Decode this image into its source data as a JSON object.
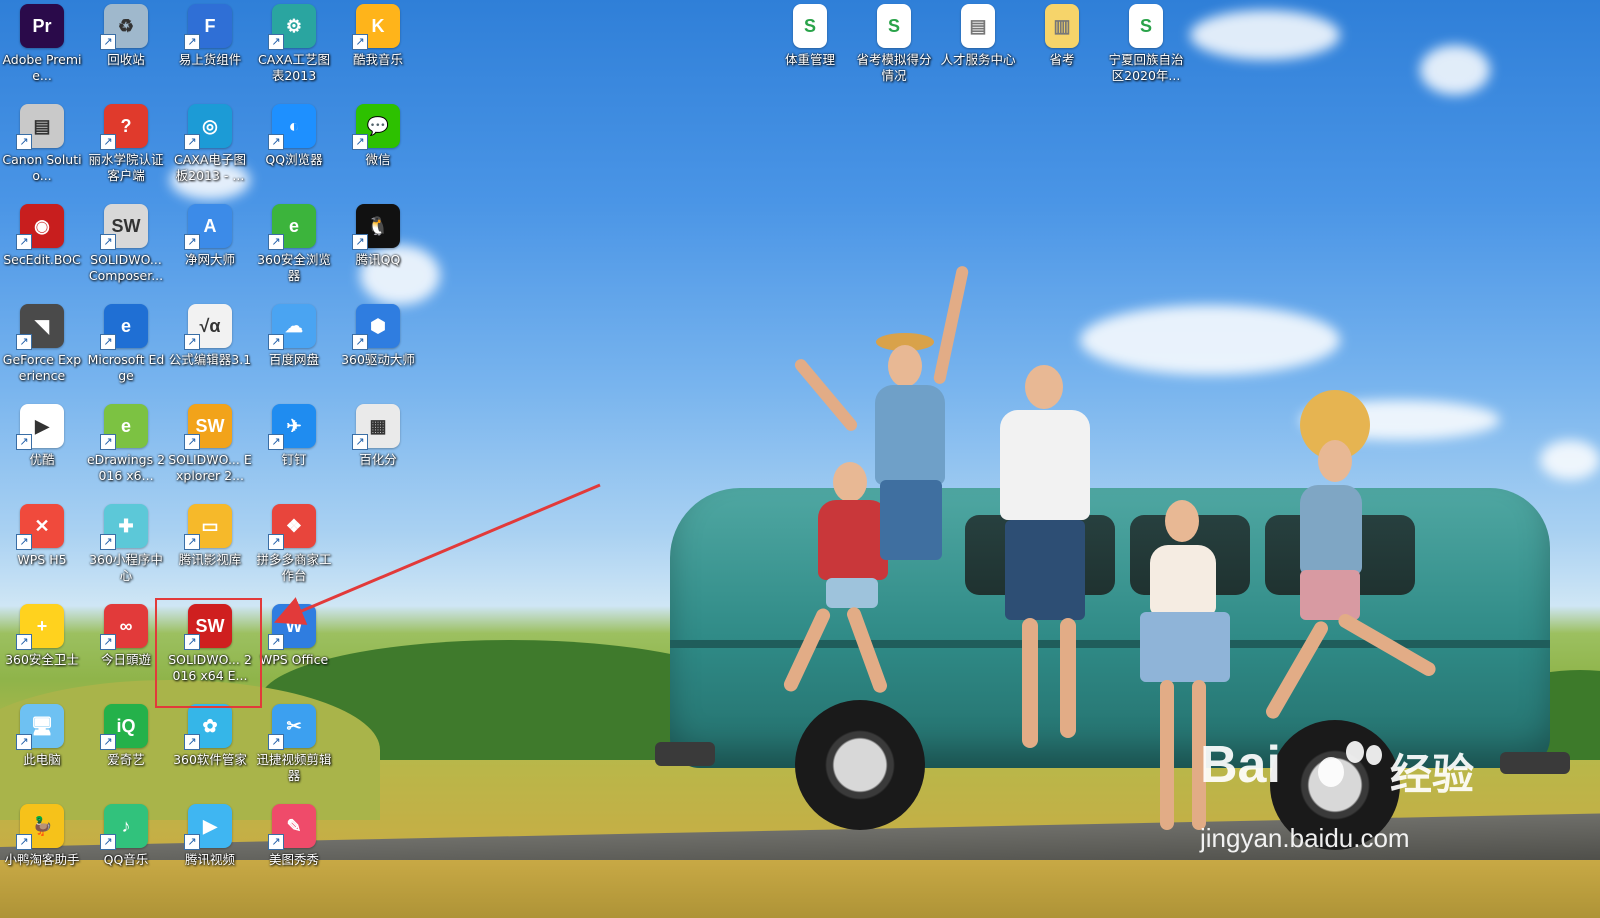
{
  "desktop": {
    "icons": [
      {
        "label": "Adobe Premie...",
        "icon": "premiere-icon",
        "glyph": "Pr",
        "color": "#2a0a4a"
      },
      {
        "label": "回收站",
        "icon": "recycle-bin-icon",
        "glyph": "♻",
        "color": "#9fb8cc"
      },
      {
        "label": "易上货组件",
        "icon": "flag-app-icon",
        "glyph": "F",
        "color": "#2f6fd6"
      },
      {
        "label": "CAXA工艺图表2013",
        "icon": "caxa-process-icon",
        "glyph": "⚙",
        "color": "#2aa5a0"
      },
      {
        "label": "酷我音乐",
        "icon": "kuwo-music-icon",
        "glyph": "K",
        "color": "#ffb41a"
      },
      {
        "label": "Canon Solutio...",
        "icon": "canon-icon",
        "glyph": "▤",
        "color": "#c9c9c9"
      },
      {
        "label": "丽水学院认证客户端",
        "icon": "auth-client-icon",
        "glyph": "?",
        "color": "#e03a2c"
      },
      {
        "label": "CAXA电子图板2013 - ...",
        "icon": "caxa-draft-icon",
        "glyph": "◎",
        "color": "#1c9bd6"
      },
      {
        "label": "QQ浏览器",
        "icon": "qq-browser-icon",
        "glyph": "◐",
        "color": "#1e90ff"
      },
      {
        "label": "微信",
        "icon": "wechat-icon",
        "glyph": "💬",
        "color": "#2dc100"
      },
      {
        "label": "SecEdit.BOC",
        "icon": "secedit-icon",
        "glyph": "◉",
        "color": "#c81e1e"
      },
      {
        "label": "SOLIDWO... Composer...",
        "icon": "solidworks-composer-icon",
        "glyph": "SW",
        "color": "#d8d8d8"
      },
      {
        "label": "净网大师",
        "icon": "jingwang-icon",
        "glyph": "A",
        "color": "#3c8be8"
      },
      {
        "label": "360安全浏览器",
        "icon": "360-browser-icon",
        "glyph": "e",
        "color": "#3cb43c"
      },
      {
        "label": "腾讯QQ",
        "icon": "qq-icon",
        "glyph": "🐧",
        "color": "#111111"
      },
      {
        "label": "GeForce Experience",
        "icon": "geforce-icon",
        "glyph": "◥",
        "color": "#4a4a4a"
      },
      {
        "label": "Microsoft Edge",
        "icon": "edge-icon",
        "glyph": "e",
        "color": "#1f6fd4"
      },
      {
        "label": "公式编辑器3.1",
        "icon": "equation-editor-icon",
        "glyph": "√α",
        "color": "#f2f2f2"
      },
      {
        "label": "百度网盘",
        "icon": "baidu-netdisk-icon",
        "glyph": "☁",
        "color": "#4aa4f2"
      },
      {
        "label": "360驱动大师",
        "icon": "360-driver-icon",
        "glyph": "⬢",
        "color": "#2f7de0"
      },
      {
        "label": "优酷",
        "icon": "youku-icon",
        "glyph": "▶",
        "color": "#ffffff"
      },
      {
        "label": "eDrawings 2016 x6...",
        "icon": "edrawings-icon",
        "glyph": "e",
        "color": "#7cc242"
      },
      {
        "label": "SOLIDWO... Explorer 2...",
        "icon": "solidworks-explorer-icon",
        "glyph": "SW",
        "color": "#f2a31a"
      },
      {
        "label": "钉钉",
        "icon": "dingtalk-icon",
        "glyph": "✈",
        "color": "#1f8cf0"
      },
      {
        "label": "百化分",
        "icon": "document-icon",
        "glyph": "▦",
        "color": "#eaeaea"
      },
      {
        "label": "WPS H5",
        "icon": "wps-h5-icon",
        "glyph": "✕",
        "color": "#f04a3c"
      },
      {
        "label": "360小程序中心",
        "icon": "360-miniapp-icon",
        "glyph": "✚",
        "color": "#5cc8d8"
      },
      {
        "label": "腾讯影视库",
        "icon": "tencent-video-lib-icon",
        "glyph": "▭",
        "color": "#f6b92a"
      },
      {
        "label": "拼多多商家工作台",
        "icon": "pinduoduo-icon",
        "glyph": "❖",
        "color": "#e8453c"
      },
      {
        "label": "360安全卫士",
        "icon": "360-security-icon",
        "glyph": "+",
        "color": "#ffd21e"
      },
      {
        "label": "今日頭遊",
        "icon": "toutiao-icon",
        "glyph": "∞",
        "color": "#e23a3a"
      },
      {
        "label": "SOLIDWO... 2016 x64 E...",
        "icon": "solidworks-icon",
        "glyph": "SW",
        "color": "#cf1f1f"
      },
      {
        "label": "WPS Office",
        "icon": "wps-office-icon",
        "glyph": "W",
        "color": "#2f7de0"
      },
      {
        "label": "此电脑",
        "icon": "this-pc-icon",
        "glyph": "🖥",
        "color": "#6ec1f2"
      },
      {
        "label": "爱奇艺",
        "icon": "iqiyi-icon",
        "glyph": "iQ",
        "color": "#24b14a"
      },
      {
        "label": "360软件管家",
        "icon": "360-software-icon",
        "glyph": "✿",
        "color": "#35b6e8"
      },
      {
        "label": "迅捷视频剪辑器",
        "icon": "video-editor-icon",
        "glyph": "✂",
        "color": "#3ca0f0"
      },
      {
        "label": "小鸭淘客助手",
        "icon": "duck-icon",
        "glyph": "🦆",
        "color": "#f6c21a"
      },
      {
        "label": "QQ音乐",
        "icon": "qq-music-icon",
        "glyph": "♪",
        "color": "#31c27c"
      },
      {
        "label": "腾讯视频",
        "icon": "tencent-video-icon",
        "glyph": "▶",
        "color": "#3fb6f2"
      },
      {
        "label": "美图秀秀",
        "icon": "meitu-icon",
        "glyph": "✎",
        "color": "#ef4b6a"
      }
    ],
    "top_icons": [
      {
        "label": "体重管理",
        "icon": "spreadsheet-icon",
        "glyph": "S",
        "color": "#ffffff"
      },
      {
        "label": "省考模拟得分情况",
        "icon": "spreadsheet-icon",
        "glyph": "S",
        "color": "#ffffff"
      },
      {
        "label": "人才服务中心",
        "icon": "document-icon",
        "glyph": "▤",
        "color": "#ffffff"
      },
      {
        "label": "省考",
        "icon": "folder-icon",
        "glyph": "▥",
        "color": "#f6d46a"
      },
      {
        "label": "宁夏回族自治区2020年...",
        "icon": "spreadsheet-icon",
        "glyph": "S",
        "color": "#ffffff"
      }
    ]
  },
  "watermark": {
    "brand_left": "Bai",
    "brand_right": "经验",
    "url": "jingyan.baidu.com"
  },
  "annotation": {
    "highlight_color": "#e23a3a"
  }
}
